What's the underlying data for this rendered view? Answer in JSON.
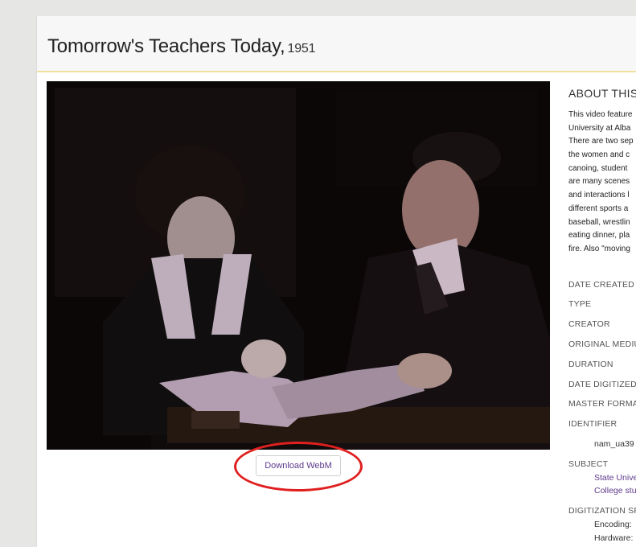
{
  "page": {
    "title": "Tomorrow's Teachers Today,",
    "year": "1951"
  },
  "video": {
    "download_label": "Download WebM"
  },
  "sidebar": {
    "about_heading": "ABOUT THIS",
    "description_lines": [
      "This video feature",
      "University at Alba",
      "There are two sep",
      "the women and c",
      "canoing, student",
      "are many scenes",
      "and interactions l",
      "different sports a",
      "baseball, wrestlin",
      "eating dinner, pla",
      "fire. Also \"moving"
    ],
    "fields": {
      "date_created": "DATE CREATED",
      "type": "TYPE",
      "creator": "CREATOR",
      "original_medium": "ORIGINAL MEDIU",
      "duration": "DURATION",
      "date_digitized": "DATE DIGITIZED",
      "master_format": "MASTER FORMA",
      "identifier": "IDENTIFIER",
      "subject": "SUBJECT",
      "digitization_specs": "DIGITIZATION SP"
    },
    "identifier_value": "nam_ua39",
    "subjects": [
      "State Unive",
      "College stu"
    ],
    "specs": {
      "encoding_label": "Encoding:",
      "hardware_label": "Hardware:"
    }
  }
}
